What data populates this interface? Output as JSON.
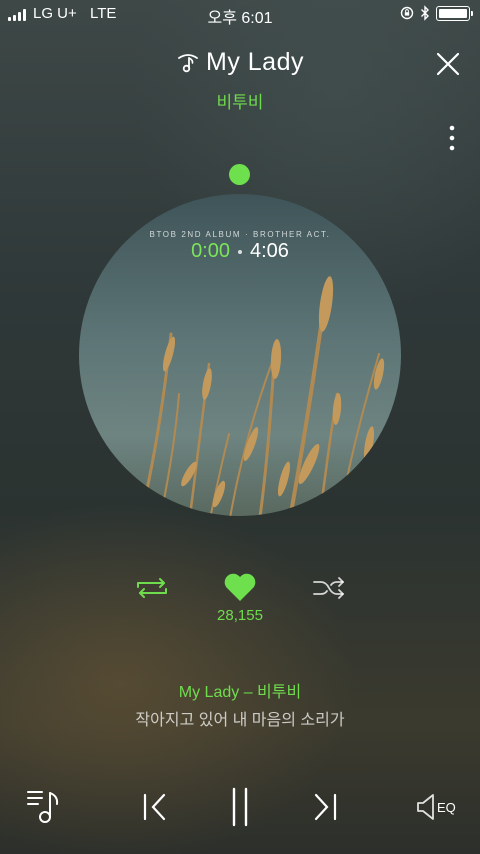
{
  "status_bar": {
    "carrier": "LG U+",
    "network": "LTE",
    "time": "오후 6:01",
    "signal_icon": "signal-bars-icon",
    "rotation_lock_icon": "rotation-lock-icon",
    "bluetooth_icon": "bluetooth-icon",
    "battery_icon": "battery-icon"
  },
  "header": {
    "title": "My Lady",
    "artist": "비투비",
    "title_icon": "music-note-icon",
    "close_icon": "close-icon",
    "more_icon": "more-vertical-icon"
  },
  "player": {
    "album_line": "BTOB 2ND ALBUM · BROTHER ACT.",
    "current_time": "0:00",
    "total_time": "4:06",
    "progress": 0
  },
  "actions": {
    "repeat_icon": "repeat-icon",
    "heart_icon": "heart-icon",
    "shuffle_icon": "shuffle-icon",
    "like_count": "28,155"
  },
  "lyrics": {
    "title": "My Lady – 비투비",
    "line": "작아지고 있어 내 마음의 소리가"
  },
  "bottom_bar": {
    "playlist_icon": "playlist-icon",
    "previous_icon": "previous-icon",
    "pause_icon": "pause-icon",
    "next_icon": "next-icon",
    "eq_icon": "speaker-eq-icon",
    "eq_label": "EQ"
  },
  "colors": {
    "accent": "#6fdc4e",
    "background": "#303938"
  }
}
